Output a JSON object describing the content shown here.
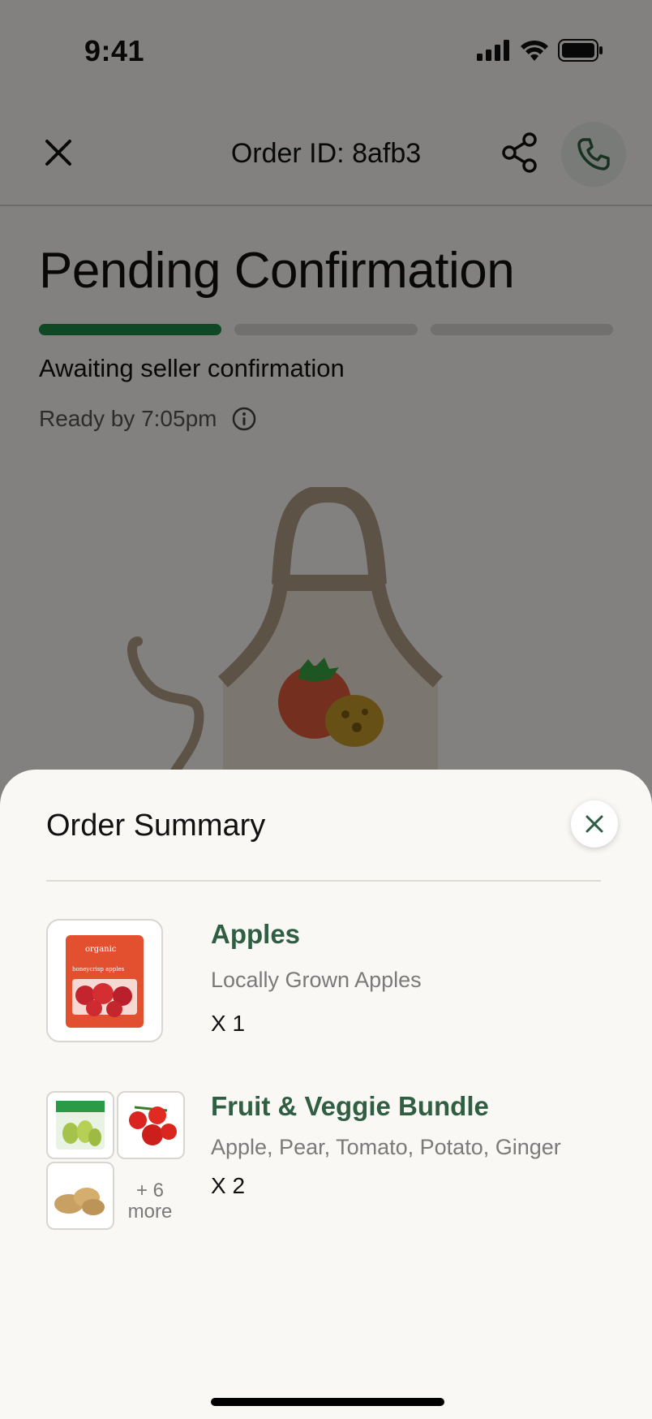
{
  "status_bar": {
    "time": "9:41",
    "icons": [
      "signal-icon",
      "wifi-icon",
      "battery-icon"
    ]
  },
  "header": {
    "order_id": "Order ID: 8afb3",
    "icons": {
      "close": "close-icon",
      "share": "share-icon",
      "call": "phone-icon"
    }
  },
  "order_status": {
    "title": "Pending Confirmation",
    "progress_steps_total": 3,
    "progress_steps_completed": 1,
    "subtitle": "Awaiting seller confirmation",
    "ready_by": "Ready by 7:05pm"
  },
  "colors": {
    "accent_green": "#1c8a45",
    "item_name_green": "#2f5e42",
    "sheet_background": "#faf8f4"
  },
  "order_summary": {
    "title": "Order Summary",
    "items": [
      {
        "name": "Apples",
        "description": "Locally Grown Apples",
        "quantity": "X 1",
        "thumbnail_text": "honeycrisp apples",
        "thumbnail_brand": "organic"
      },
      {
        "name": "Fruit & Veggie Bundle",
        "description": "Apple, Pear, Tomato, Potato, Ginger",
        "quantity": "X 2",
        "thumbnails": [
          "pears-icon",
          "tomatoes-icon",
          "potatoes-icon"
        ],
        "more_count": "+ 6",
        "more_label": "more"
      }
    ]
  }
}
